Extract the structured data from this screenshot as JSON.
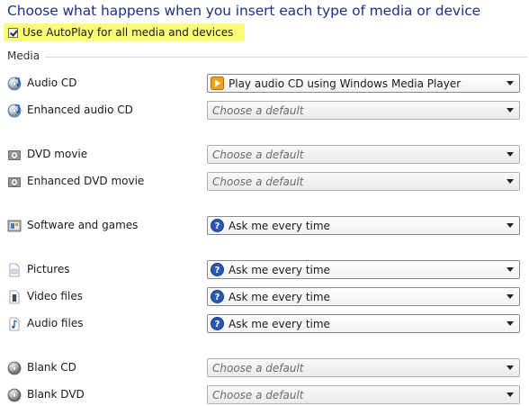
{
  "heading": "Choose what happens when you insert each type of media or device",
  "autoplay": {
    "label": "Use AutoPlay for all media and devices",
    "checked": true,
    "highlight_color": "#fbfb7a"
  },
  "media_section": {
    "label": "Media"
  },
  "items": [
    {
      "label": "Audio CD",
      "icon": "disc-audio-icon",
      "value": "Play audio CD using Windows Media Player",
      "value_icon": "media-player-icon",
      "placeholder": false
    },
    {
      "label": "Enhanced audio CD",
      "icon": "disc-audio-icon",
      "value": "Choose a default",
      "value_icon": "",
      "placeholder": true
    },
    {
      "label": "DVD movie",
      "icon": "dvd-icon",
      "value": "Choose a default",
      "value_icon": "",
      "placeholder": true
    },
    {
      "label": "Enhanced DVD movie",
      "icon": "dvd-icon",
      "value": "Choose a default",
      "value_icon": "",
      "placeholder": true
    },
    {
      "label": "Software and games",
      "icon": "software-icon",
      "value": "Ask me every time",
      "value_icon": "question-icon",
      "placeholder": false
    },
    {
      "label": "Pictures",
      "icon": "pictures-icon",
      "value": "Ask me every time",
      "value_icon": "question-icon",
      "placeholder": false
    },
    {
      "label": "Video files",
      "icon": "video-file-icon",
      "value": "Ask me every time",
      "value_icon": "question-icon",
      "placeholder": false
    },
    {
      "label": "Audio files",
      "icon": "audio-file-icon",
      "value": "Ask me every time",
      "value_icon": "question-icon",
      "placeholder": false
    },
    {
      "label": "Blank CD",
      "icon": "blank-disc-icon",
      "value": "Choose a default",
      "value_icon": "",
      "placeholder": true
    },
    {
      "label": "Blank DVD",
      "icon": "blank-disc-icon",
      "value": "Choose a default",
      "value_icon": "",
      "placeholder": true
    }
  ]
}
